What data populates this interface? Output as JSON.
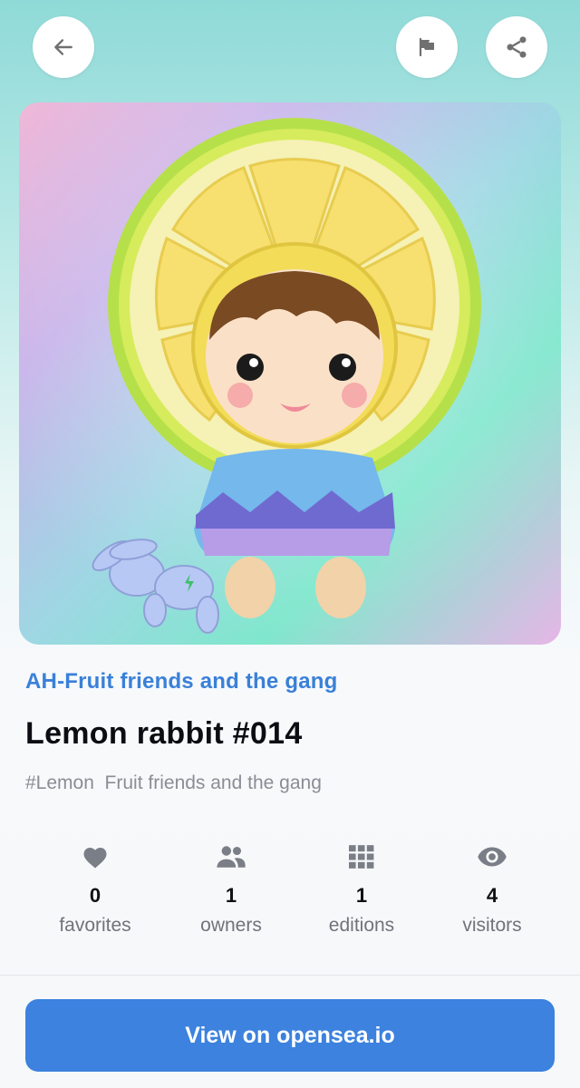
{
  "header": {
    "back_icon": "arrow-left-icon",
    "flag_icon": "flag-icon",
    "share_icon": "share-icon"
  },
  "nft": {
    "image_description": "3D character in lemon-slice hood holding a plush rabbit",
    "collection": "AH-Fruit friends and the gang",
    "title": "Lemon rabbit #014",
    "tags": "#Lemon  Fruit friends and the gang"
  },
  "stats": [
    {
      "icon": "heart-icon",
      "value": "0",
      "label": "favorites"
    },
    {
      "icon": "people-icon",
      "value": "1",
      "label": "owners"
    },
    {
      "icon": "grid-icon",
      "value": "1",
      "label": "editions"
    },
    {
      "icon": "eye-icon",
      "value": "4",
      "label": "visitors"
    }
  ],
  "cta": {
    "label": "View on opensea.io"
  },
  "colors": {
    "accent": "#3c82de",
    "link": "#3a80d8",
    "muted": "#8a8d94"
  }
}
